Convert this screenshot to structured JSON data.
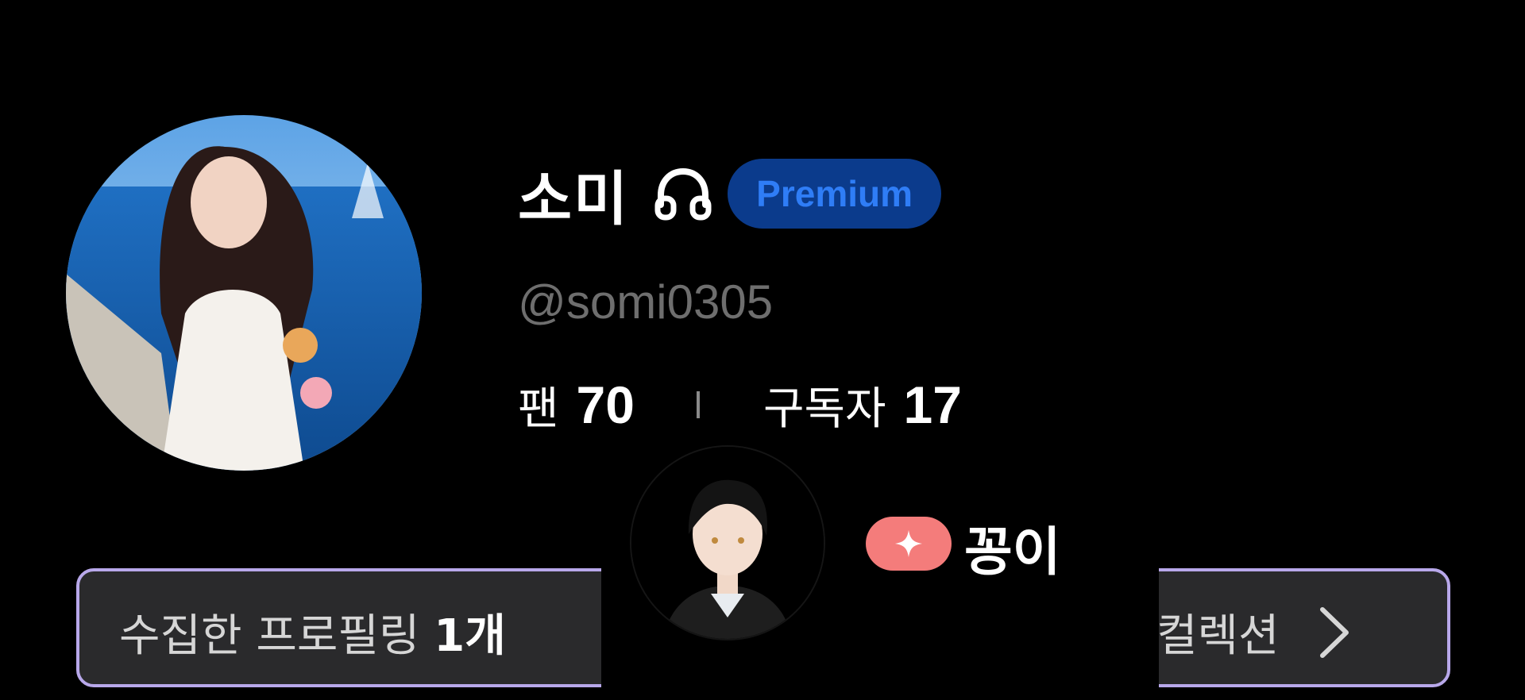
{
  "profile": {
    "name": "소미",
    "badge": "Premium",
    "handle": "@somi0305",
    "avatar_icon": "profile-photo",
    "name_icon": "headphone-icon"
  },
  "stats": {
    "fans_label": "팬",
    "fans_value": "70",
    "subscribers_label": "구독자",
    "subscribers_value": "17"
  },
  "collection": {
    "collected_prefix": "수집한 프로필링",
    "collected_count": "1개",
    "link_label": "컬렉션",
    "chevron_icon": "chevron-right-icon"
  },
  "overlay_user": {
    "name": "꽁이",
    "badge_icon": "sparkle-icon"
  },
  "colors": {
    "background": "#000000",
    "premium_bg": "#0b3b8c",
    "premium_text": "#2f7df6",
    "handle": "#6e6e6e",
    "bar_bg": "#2a2a2c",
    "bar_border": "#b8a8ea",
    "sparkle_bg": "#f47c7b"
  }
}
